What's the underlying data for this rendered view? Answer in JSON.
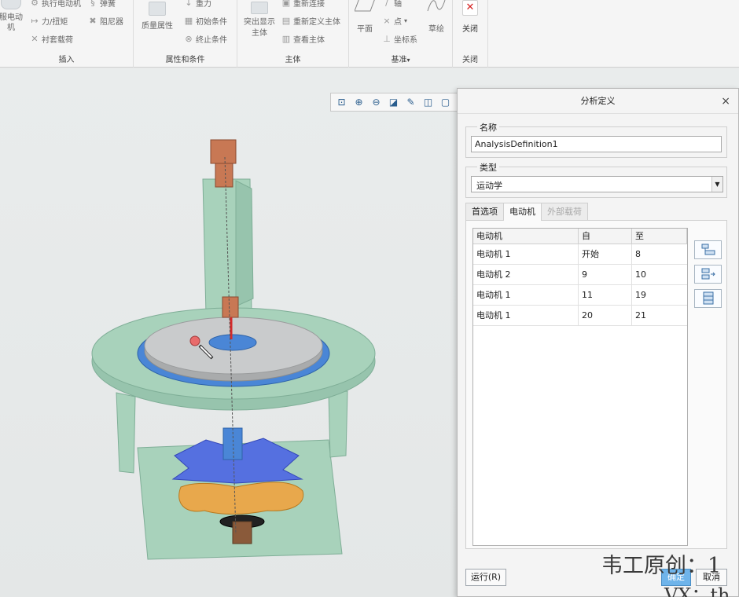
{
  "ribbon": {
    "insert_group": {
      "label": "插入",
      "servo_motor_label": "服电动\n机",
      "items": [
        "执行电动机",
        "力/扭矩",
        "衬套载荷"
      ],
      "spring_label": "弹簧",
      "damper_label": "阻尼器"
    },
    "props_group": {
      "label": "属性和条件",
      "mass_label": "质量属性",
      "items": [
        "重力",
        "初始条件",
        "终止条件"
      ]
    },
    "body_group": {
      "label": "主体",
      "highlight_label": "突出显示\n主体",
      "items": [
        "重新连接",
        "重新定义主体",
        "查看主体"
      ]
    },
    "datum_group": {
      "label": "基准",
      "plane_label": "平面",
      "items": [
        "轴",
        "点",
        "坐标系"
      ],
      "sketch_label": "草绘"
    },
    "close_group": {
      "label": "关闭",
      "close_label": "关闭"
    }
  },
  "dialog": {
    "title": "分析定义",
    "name_group_label": "名称",
    "name_value": "AnalysisDefinition1",
    "type_group_label": "类型",
    "type_value": "运动学",
    "tabs": [
      {
        "label": "首选项",
        "state": "normal"
      },
      {
        "label": "电动机",
        "state": "active"
      },
      {
        "label": "外部载荷",
        "state": "disabled"
      }
    ],
    "table": {
      "headers": [
        "电动机",
        "自",
        "至"
      ],
      "rows": [
        [
          "电动机 1",
          "开始",
          "8"
        ],
        [
          "电动机 2",
          "9",
          "10"
        ],
        [
          "电动机 1",
          "11",
          "19"
        ],
        [
          "电动机 1",
          "20",
          "21"
        ]
      ]
    },
    "run_label": "运行(R)",
    "ok_label": "确定",
    "cancel_label": "取消"
  },
  "watermark": {
    "line1": "韦工原创：1",
    "line2": "VX：th"
  },
  "colors": {
    "base_green": "#a8d2bb",
    "plate_grey": "#c9cbcc",
    "plate_blue": "#4a86d6",
    "wheel_blue": "#5570e0",
    "cam_orange": "#e8a84c",
    "accent_blue": "#6fb4ea"
  }
}
